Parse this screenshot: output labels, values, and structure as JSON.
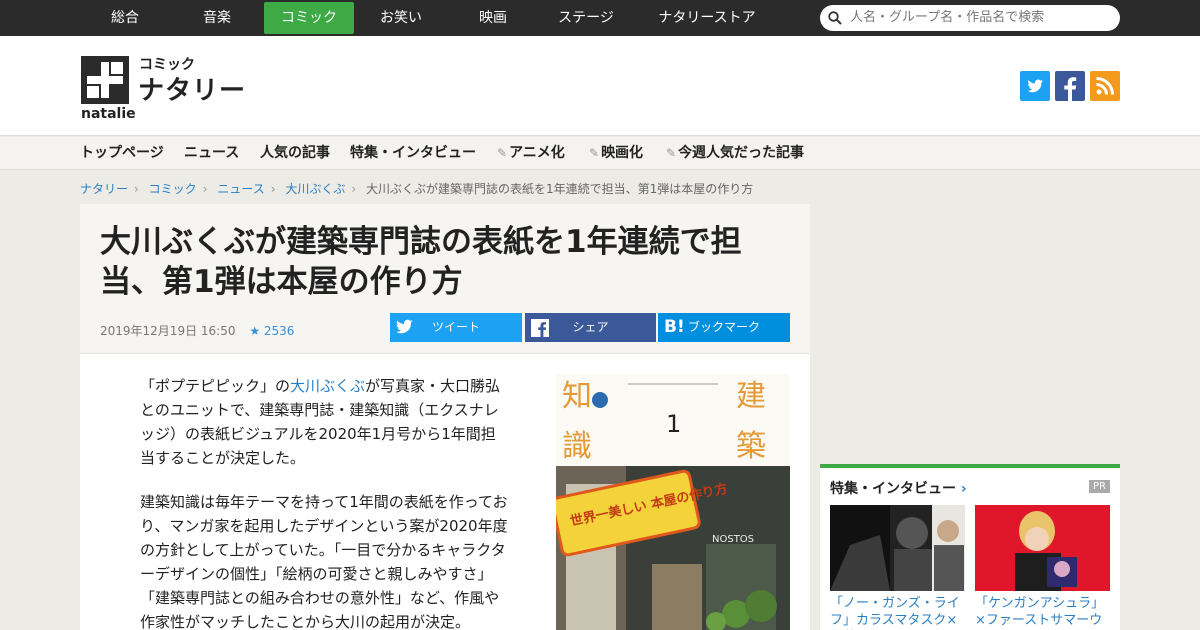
{
  "topnav": {
    "items": [
      "総合",
      "音楽",
      "コミック",
      "お笑い",
      "映画",
      "ステージ",
      "ナタリーストア"
    ],
    "active": "コミック",
    "search_placeholder": "人名・グループ名・作品名で検索"
  },
  "logo": {
    "category": "コミック",
    "name": "ナタリー",
    "sub": "natalie"
  },
  "social": [
    "twitter-icon",
    "facebook-icon",
    "rss-icon"
  ],
  "subnav": [
    "トップページ",
    "ニュース",
    "人気の記事",
    "特集・インタビュー",
    "アニメ化",
    "映画化",
    "今週人気だった記事"
  ],
  "breadcrumb": [
    "ナタリー",
    "コミック",
    "ニュース",
    "大川ぶくぶ",
    "大川ぶくぶが建築専門誌の表紙を1年連続で担当、第1弾は本屋の作り方"
  ],
  "article": {
    "title": "大川ぶくぶが建築専門誌の表紙を1年連続で担当、第1弾は本屋の作り方",
    "date": "2019年12月19日 16:50",
    "stars": "2536",
    "share": {
      "tweet": "ツイート",
      "facebook": "シェア",
      "hatena": "ブックマーク"
    },
    "p1_pre": "「ポプテピピック」の",
    "p1_link": "大川ぶくぶ",
    "p1_post": "が写真家・大口勝弘とのユニットで、建築専門誌・建築知識（エクスナレッジ）の表紙ビジュアルを2020年1月号から1年間担当することが決定した。",
    "p2": "建築知識は毎年テーマを持って1年間の表紙を作っており、マンガ家を起用したデザインという案が2020年度の方針として上がっていた。「一目で分かるキャラクターデザインの個性」「絵柄の可愛さと親しみやすさ」「建築専門誌との組み合わせの意外性」など、作風や作家性がマッチしたことから大川の起用が決定。"
  },
  "cover": {
    "left_top": "知",
    "left_bottom": "識",
    "right_top": "建",
    "right_bottom": "築",
    "issue": "1",
    "banner": "世界一美しい 本屋の作り方",
    "shop": "NOSTOS"
  },
  "sidebar": {
    "heading": "特集・インタビュー",
    "pr": "PR",
    "cards": [
      {
        "caption": "「ノー・ガンズ・ライフ」カラスマタスク×伊藤祐往"
      },
      {
        "caption": "「ケンガンアシュラ」×ファーストサマーウイカ"
      }
    ]
  },
  "colors": {
    "accent": "#3daa46",
    "link": "#2a7fc4",
    "twitter": "#1da1f2",
    "facebook": "#3b5998",
    "hatena": "#008fde",
    "rss": "#f39a1d"
  }
}
